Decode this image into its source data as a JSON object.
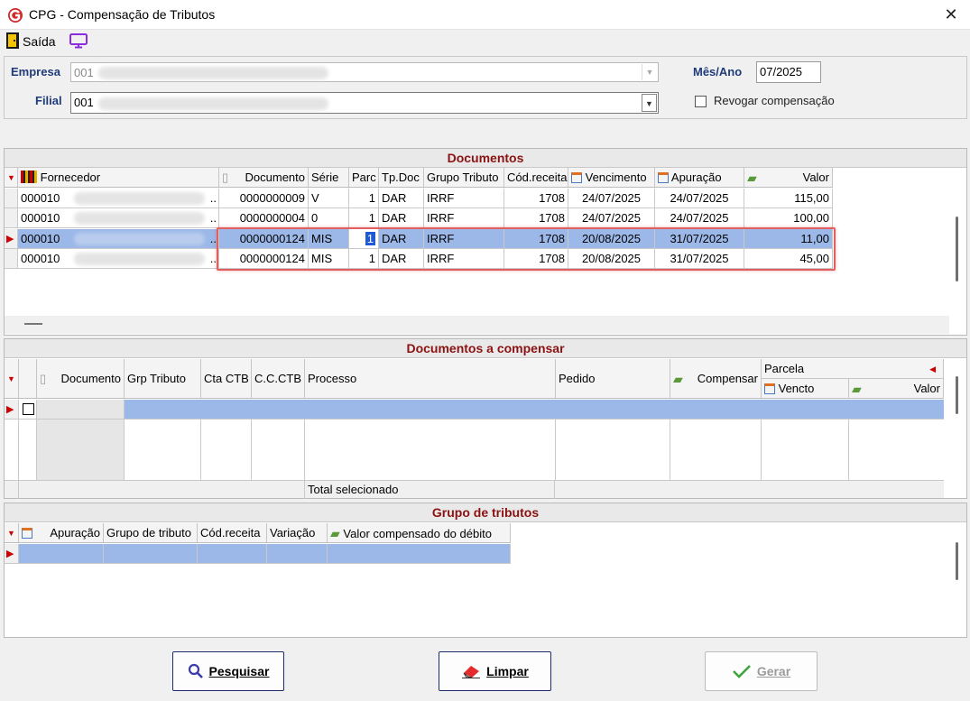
{
  "window": {
    "title": "CPG - Compensação de Tributos",
    "close_glyph": "✕"
  },
  "toolbar": {
    "saida_label": "Saída"
  },
  "filters": {
    "empresa_label": "Empresa",
    "empresa_value": "001",
    "filial_label": "Filial",
    "filial_value": "001",
    "mesano_label": "Mês/Ano",
    "mesano_value": "07/2025",
    "revogar_label": "Revogar compensação"
  },
  "documentos": {
    "title": "Documentos",
    "columns": [
      "Fornecedor",
      "Documento",
      "Série",
      "Parc",
      "Tp.Doc",
      "Grupo Tributo",
      "Cód.receita",
      "Vencimento",
      "Apuração",
      "Valor"
    ],
    "rows": [
      {
        "fornecedor": "000010",
        "ellipsis": "..",
        "documento": "0000000009",
        "serie": "V",
        "parc": "1",
        "tpdoc": "DAR",
        "grupo": "IRRF",
        "cod": "1708",
        "venc": "24/07/2025",
        "apur": "24/07/2025",
        "valor": "115,00"
      },
      {
        "fornecedor": "000010",
        "ellipsis": "..",
        "documento": "0000000004",
        "serie": "0",
        "parc": "1",
        "tpdoc": "DAR",
        "grupo": "IRRF",
        "cod": "1708",
        "venc": "24/07/2025",
        "apur": "24/07/2025",
        "valor": "100,00"
      },
      {
        "fornecedor": "000010",
        "ellipsis": "..",
        "documento": "0000000124",
        "serie": "MIS",
        "parc": "1",
        "tpdoc": "DAR",
        "grupo": "IRRF",
        "cod": "1708",
        "venc": "20/08/2025",
        "apur": "31/07/2025",
        "valor": "11,00"
      },
      {
        "fornecedor": "000010",
        "ellipsis": "..",
        "documento": "0000000124",
        "serie": "MIS",
        "parc": "1",
        "tpdoc": "DAR",
        "grupo": "IRRF",
        "cod": "1708",
        "venc": "20/08/2025",
        "apur": "31/07/2025",
        "valor": "45,00"
      }
    ]
  },
  "compensar": {
    "title": "Documentos a compensar",
    "columns": [
      "Documento",
      "Grp Tributo",
      "Cta CTB",
      "C.C.CTB",
      "Processo",
      "Pedido",
      "Compensar",
      "Parcela",
      "Vencto",
      "Valor"
    ],
    "total_label": "Total selecionado"
  },
  "grupo": {
    "title": "Grupo de tributos",
    "columns": [
      "Apuração",
      "Grupo de tributo",
      "Cód.receita",
      "Variação",
      "Valor compensado do débito"
    ]
  },
  "buttons": {
    "pesquisar": "Pesquisar",
    "limpar": "Limpar",
    "gerar": "Gerar"
  },
  "colors": {
    "accent_red": "#c00000",
    "panel_title": "#8b1212",
    "label_blue": "#1f3b7a",
    "selection": "#9bb8e8",
    "highlight_box": "#e06060"
  }
}
